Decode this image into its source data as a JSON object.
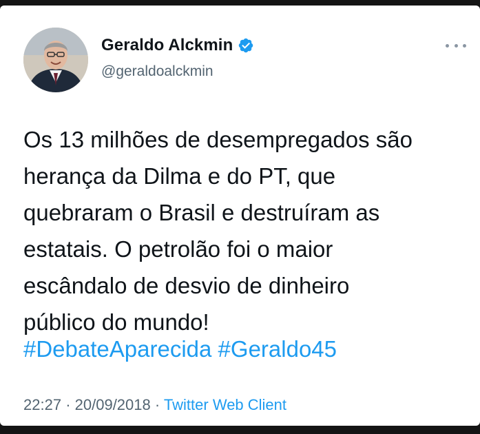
{
  "tweet": {
    "author": {
      "name": "Geraldo Alckmin",
      "handle": "@geraldoalckmin",
      "verified": true
    },
    "text": "Os 13 milhões de desempregados são\nherança da Dilma e do PT, que\nquebraram o Brasil e destruíram as\nestatais. O petrolão foi o maior\nescândalo de desvio de dinheiro\npúblico do mundo!",
    "hashtags": [
      "#DebateAparecida",
      "#Geraldo45"
    ],
    "time": "22:27",
    "separator": "·",
    "date": "20/09/2018",
    "client": "Twitter Web Client"
  },
  "icons": {
    "verified": "verified-badge-icon",
    "more": "more-options-icon"
  },
  "colors": {
    "text": "#0f1419",
    "secondary": "#536471",
    "link": "#1d9bf0",
    "background": "#ffffff",
    "outer": "#141414"
  }
}
